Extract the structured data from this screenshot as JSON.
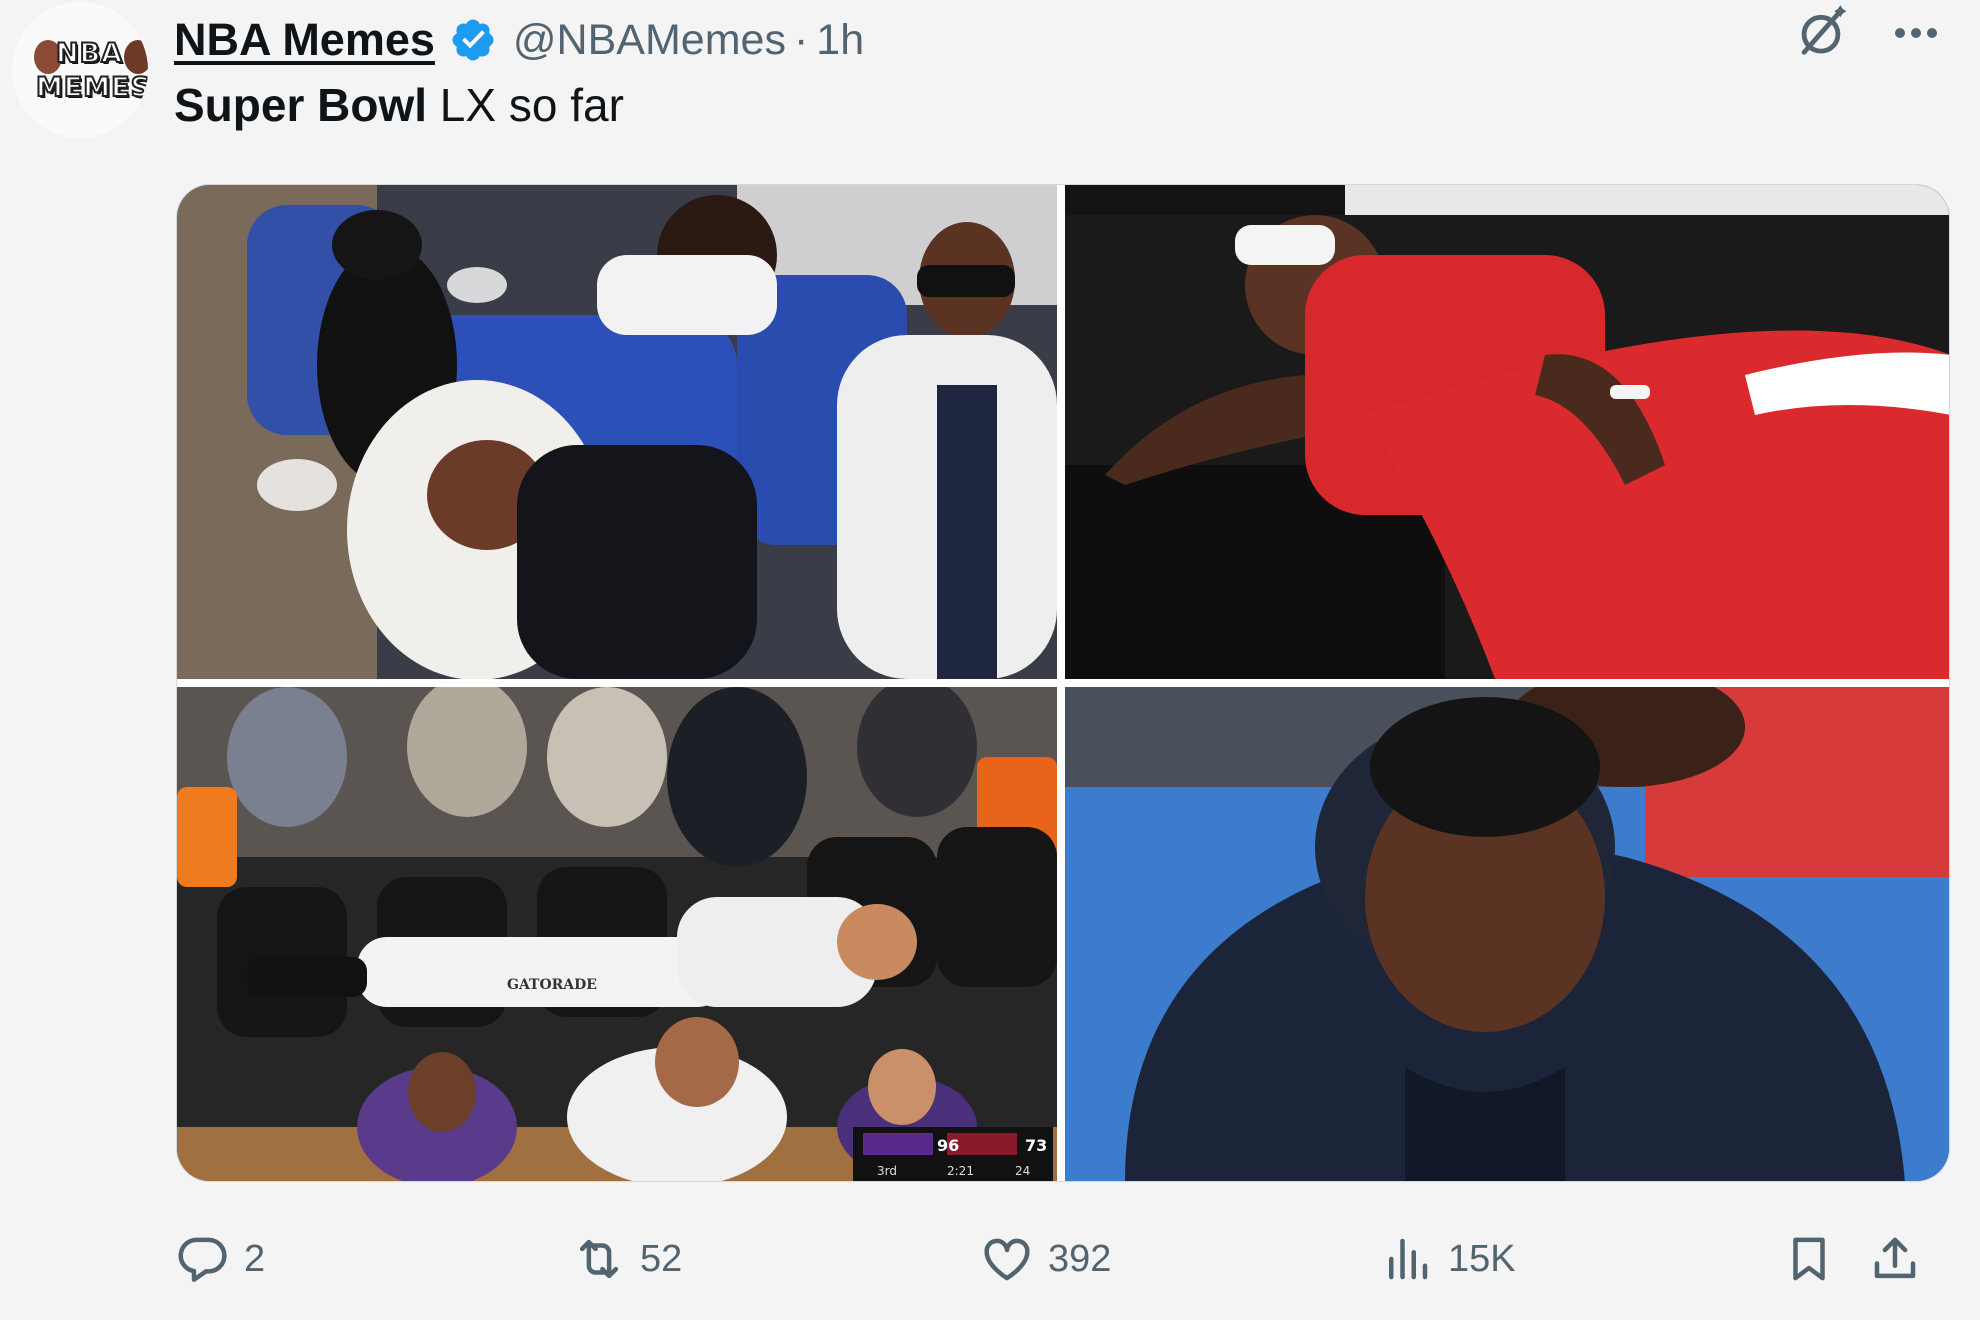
{
  "tweet": {
    "author": {
      "display_name": "NBA Memes",
      "handle": "@NBAMemes",
      "verified": true,
      "avatar_text_line1": "NBA",
      "avatar_text_line2": "MEMES"
    },
    "separator": "·",
    "timestamp": "1h",
    "text_bold": "Super Bowl",
    "text_rest": " LX so far",
    "media": [
      {
        "icon": "photo-players-sleeping-on-plane"
      },
      {
        "icon": "photo-player-sleeping-on-couch"
      },
      {
        "icon": "photo-player-lying-on-courtside-chairs"
      },
      {
        "icon": "photo-player-sleeping-on-bench"
      }
    ],
    "scoreboard": {
      "team1_score": "96",
      "team2_score": "73",
      "clock": "2:21",
      "shot": "24",
      "period": "3rd"
    },
    "sponsor_text": "GATORADE",
    "actions": {
      "replies": "2",
      "reposts": "52",
      "likes": "392",
      "views": "15K"
    }
  },
  "colors": {
    "background": "#f4f4f4",
    "text_primary": "#0f1419",
    "text_secondary": "#536471",
    "verified_blue": "#1d9bf0"
  }
}
